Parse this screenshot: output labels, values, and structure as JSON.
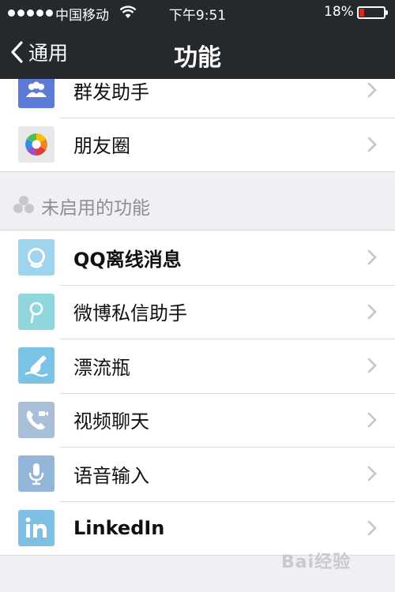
{
  "status_bar": {
    "carrier": "中国移动",
    "time": "下午9:51",
    "battery_percent": "18%",
    "battery_level": 0.18,
    "battery_color": "#e0221f"
  },
  "nav": {
    "back_label": "通用",
    "title": "功能"
  },
  "enabled_group": [
    {
      "label": "群发助手",
      "icon": "group-message-icon",
      "icon_bg": "#5b7bd5"
    },
    {
      "label": "朋友圈",
      "icon": "moments-aperture-icon",
      "icon_bg": "#e8e8e8"
    }
  ],
  "disabled_section": {
    "title": "未启用的功能",
    "icon": "disabled-features-icon"
  },
  "disabled_group": [
    {
      "label": "QQ离线消息",
      "icon": "qq-penguin-icon",
      "icon_bg": "#9fd4ef"
    },
    {
      "label": "微博私信助手",
      "icon": "weibo-icon",
      "icon_bg": "#8fd6dd"
    },
    {
      "label": "漂流瓶",
      "icon": "drift-bottle-icon",
      "icon_bg": "#7bc2e4"
    },
    {
      "label": "视频聊天",
      "icon": "video-call-icon",
      "icon_bg": "#a9bfd9"
    },
    {
      "label": "语音输入",
      "icon": "microphone-icon",
      "icon_bg": "#93b5d8"
    },
    {
      "label": "LinkedIn",
      "icon": "linkedin-icon",
      "icon_bg": "#7fbfe3"
    }
  ],
  "watermark": "Bai经验"
}
